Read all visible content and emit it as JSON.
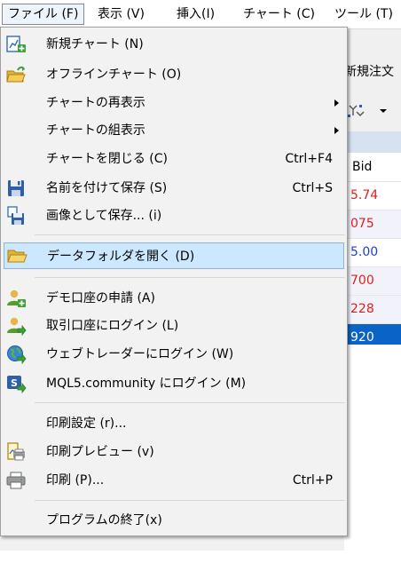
{
  "menubar": {
    "items": [
      {
        "label": "ファイル (F)",
        "active": true
      },
      {
        "label": "表示 (V)"
      },
      {
        "label": "挿入(I)"
      },
      {
        "label": "チャート (C)"
      },
      {
        "label": "ツール (T)"
      }
    ]
  },
  "background": {
    "new_order_label": "新規注文",
    "column_header": "Bid",
    "rows": [
      {
        "value": "5.74",
        "color": "#e11d1d"
      },
      {
        "value": "075",
        "color": "#e11d1d"
      },
      {
        "value": "5.00",
        "color": "#1f3fd1"
      },
      {
        "value": "700",
        "color": "#e11d1d"
      },
      {
        "value": "228",
        "color": "#e11d1d"
      },
      {
        "value": "920",
        "color": "#ffffff"
      }
    ]
  },
  "file_menu": {
    "items": [
      {
        "label": "新規チャート (N)",
        "icon": "new-chart-icon"
      },
      {
        "label": "オフラインチャート (O)",
        "icon": "offline-chart-folder-icon"
      },
      {
        "label": "チャートの再表示",
        "has_submenu": true
      },
      {
        "label": "チャートの組表示",
        "has_submenu": true
      },
      {
        "label": "チャートを閉じる (C)",
        "shortcut": "Ctrl+F4"
      },
      {
        "label": "名前を付けて保存 (S)",
        "shortcut": "Ctrl+S",
        "icon": "save-disk-icon"
      },
      {
        "label": "画像として保存... (i)",
        "icon": "save-image-icon"
      },
      {
        "label": "データフォルダを開く (D)",
        "icon": "open-folder-icon",
        "highlighted": true
      },
      {
        "label": "デモ口座の申請 (A)",
        "icon": "demo-account-user-icon"
      },
      {
        "label": "取引口座にログイン (L)",
        "icon": "login-user-icon"
      },
      {
        "label": "ウェブトレーダーにログイン (W)",
        "icon": "web-globe-icon"
      },
      {
        "label": "MQL5.community にログイン (M)",
        "icon": "mql5-icon"
      },
      {
        "label": "印刷設定 (r)..."
      },
      {
        "label": "印刷プレビュー (v)",
        "icon": "print-preview-icon"
      },
      {
        "label": "印刷 (P)...",
        "shortcut": "Ctrl+P",
        "icon": "printer-icon"
      },
      {
        "label": "プログラムの終了(x)"
      }
    ]
  }
}
